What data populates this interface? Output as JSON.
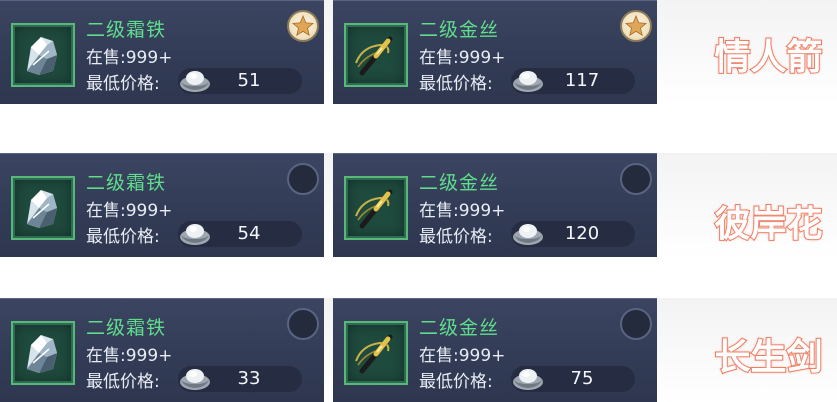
{
  "colors": {
    "card_bg": "#363f5a",
    "item_name": "#5fdc8c",
    "thumb_border": "#58b878",
    "text": "#e8ecf4",
    "tag_outline": "#ea6e52",
    "fav_on": "#f2e3c0"
  },
  "rows": [
    {
      "tag": "情人箭",
      "cards": [
        {
          "name": "二级霜铁",
          "icon": "frost-iron-icon",
          "stock_label": "在售:",
          "stock_value": "999+",
          "price_label": "最低价格:",
          "price": "51",
          "favorited": true
        },
        {
          "name": "二级金丝",
          "icon": "gold-thread-icon",
          "stock_label": "在售:",
          "stock_value": "999+",
          "price_label": "最低价格:",
          "price": "117",
          "favorited": true
        }
      ]
    },
    {
      "tag": "彼岸花",
      "cards": [
        {
          "name": "二级霜铁",
          "icon": "frost-iron-icon",
          "stock_label": "在售:",
          "stock_value": "999+",
          "price_label": "最低价格:",
          "price": "54",
          "favorited": false
        },
        {
          "name": "二级金丝",
          "icon": "gold-thread-icon",
          "stock_label": "在售:",
          "stock_value": "999+",
          "price_label": "最低价格:",
          "price": "120",
          "favorited": false
        }
      ]
    },
    {
      "tag": "长生剑",
      "cards": [
        {
          "name": "二级霜铁",
          "icon": "frost-iron-icon",
          "stock_label": "在售:",
          "stock_value": "999+",
          "price_label": "最低价格:",
          "price": "33",
          "favorited": false
        },
        {
          "name": "二级金丝",
          "icon": "gold-thread-icon",
          "stock_label": "在售:",
          "stock_value": "999+",
          "price_label": "最低价格:",
          "price": "75",
          "favorited": false
        }
      ]
    }
  ]
}
